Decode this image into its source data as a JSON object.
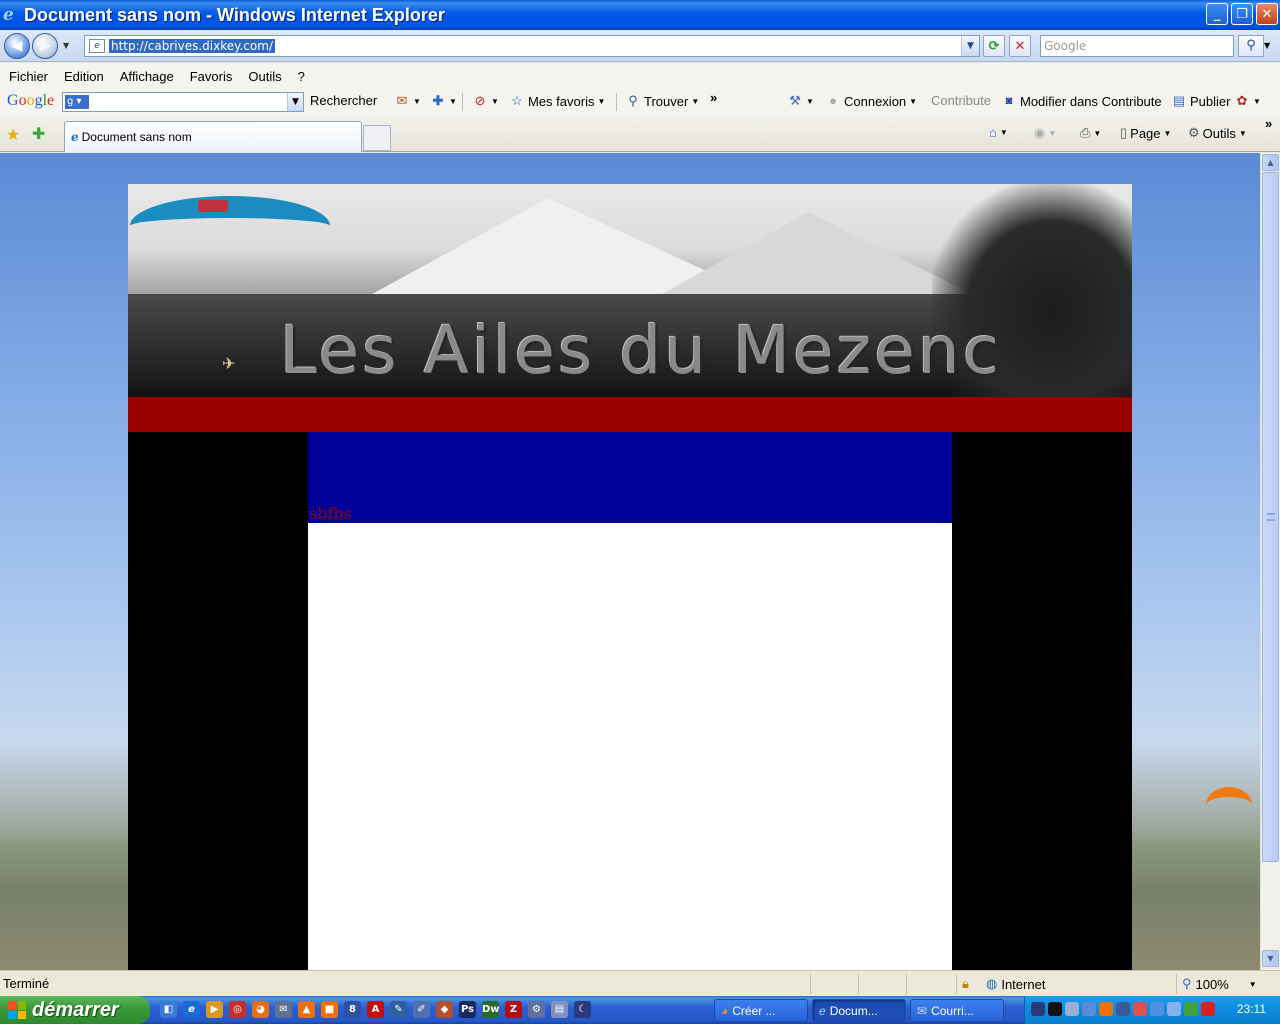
{
  "window": {
    "title": "Document sans nom - Windows Internet Explorer"
  },
  "address_bar": {
    "url": "http://cabrives.dixkey.com/"
  },
  "search_box": {
    "placeholder": "Google"
  },
  "menu": {
    "items": [
      "Fichier",
      "Edition",
      "Affichage",
      "Favoris",
      "Outils",
      "?"
    ]
  },
  "google_toolbar": {
    "search_label": "Rechercher",
    "favorites_label": "Mes favoris",
    "find_label": "Trouver",
    "login_label": "Connexion",
    "contribute_label": "Contribute",
    "edit_contribute_label": "Modifier dans Contribute",
    "publish_label": "Publier"
  },
  "tab": {
    "title": "Document sans nom"
  },
  "command_bar": {
    "page_label": "Page",
    "tools_label": "Outils"
  },
  "page": {
    "banner_title": "Les Ailes du Mezenc",
    "content_text": "sbfbs",
    "colors": {
      "red_bar": "#990000",
      "blue_box": "#000099",
      "side": "#000000"
    }
  },
  "status_bar": {
    "text": "Terminé",
    "zone": "Internet",
    "zoom": "100%"
  },
  "taskbar": {
    "start_label": "démarrer",
    "tasks": [
      "Créer ...",
      "Docum...",
      "Courri..."
    ],
    "clock": "23:11"
  }
}
